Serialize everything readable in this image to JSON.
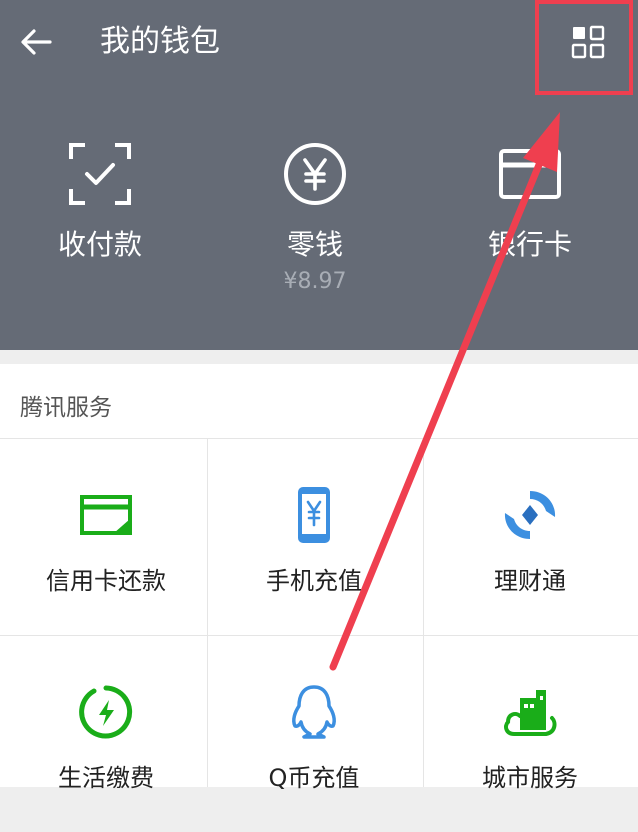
{
  "header": {
    "title": "我的钱包",
    "back_icon": "back-arrow-icon",
    "menu_icon": "grid-menu-icon"
  },
  "wallet": [
    {
      "label": "收付款",
      "icon": "scan-pay-icon"
    },
    {
      "label": "零钱",
      "icon": "yuan-icon",
      "amount": "¥8.97"
    },
    {
      "label": "银行卡",
      "icon": "bank-card-icon"
    }
  ],
  "services": {
    "section_title": "腾讯服务",
    "items": [
      {
        "label": "信用卡还款",
        "icon": "credit-card-repay-icon"
      },
      {
        "label": "手机充值",
        "icon": "phone-recharge-icon"
      },
      {
        "label": "理财通",
        "icon": "wealth-icon"
      },
      {
        "label": "生活缴费",
        "icon": "lightning-bill-icon"
      },
      {
        "label": "Q币充值",
        "icon": "qq-penguin-icon"
      },
      {
        "label": "城市服务",
        "icon": "city-services-icon"
      }
    ]
  },
  "colors": {
    "header_bg": "#656b76",
    "accent_green": "#1aad19",
    "accent_blue": "#3c8fe0",
    "annotation_red": "#ef3f4f"
  }
}
